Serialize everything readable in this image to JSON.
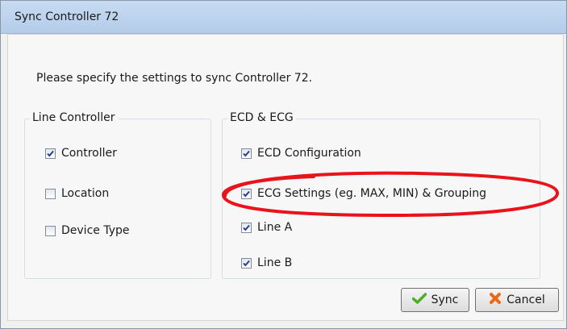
{
  "window": {
    "title": "Sync Controller 72"
  },
  "instruction": "Please specify the settings to sync Controller 72.",
  "line_controller_group": {
    "title": "Line Controller",
    "items": [
      {
        "label": "Controller",
        "checked": true
      },
      {
        "label": "Location",
        "checked": false
      },
      {
        "label": "Device Type",
        "checked": false
      }
    ]
  },
  "ecd_ecg_group": {
    "title": "ECD & ECG",
    "items": [
      {
        "label": "ECD Configuration",
        "checked": true
      },
      {
        "label": "ECG Settings (eg. MAX, MIN) & Grouping",
        "checked": true
      },
      {
        "label": "Line A",
        "checked": true
      },
      {
        "label": "Line B",
        "checked": true
      }
    ]
  },
  "buttons": {
    "sync_label": "Sync",
    "cancel_label": "Cancel"
  },
  "icons": {
    "sync": "checkmark-icon",
    "cancel": "x-icon"
  },
  "colors": {
    "titlebar": "#b8d0ec",
    "annotation": "#e8131b",
    "check": "#2b3a8f",
    "sync_icon": "#4caf2a",
    "cancel_icon": "#e86a17"
  }
}
